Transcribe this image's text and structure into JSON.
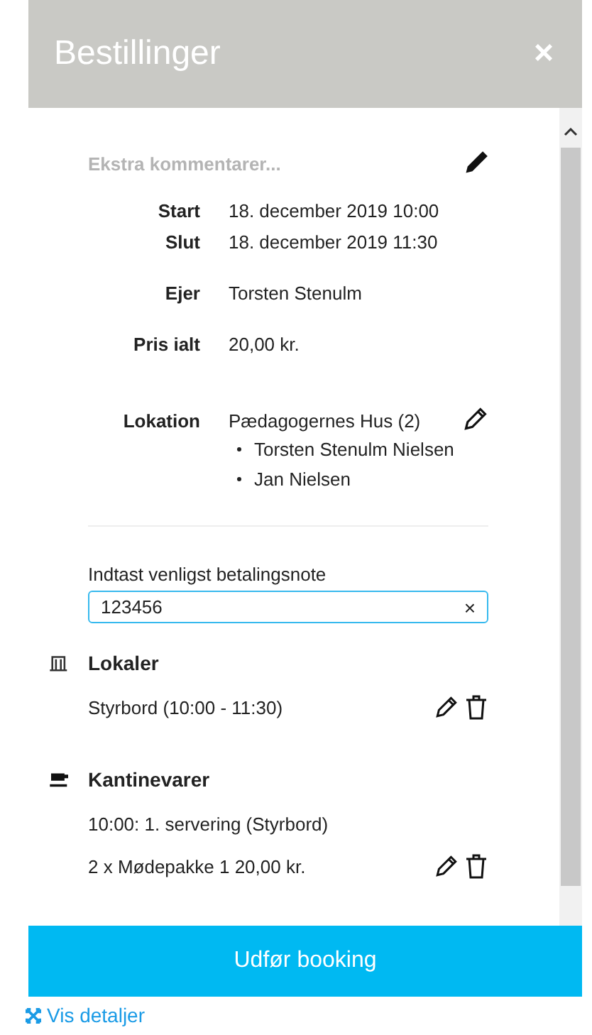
{
  "header": {
    "title": "Bestillinger",
    "close": "×"
  },
  "comment": {
    "placeholder": "Ekstra kommentarer..."
  },
  "details": [
    {
      "label": "Start",
      "value": "18. december 2019 10:00"
    },
    {
      "label": "Slut",
      "value": "18. december 2019 11:30"
    },
    {
      "label": "Ejer",
      "value": "Torsten Stenulm"
    },
    {
      "label": "Pris ialt",
      "value": "20,00 kr."
    }
  ],
  "location": {
    "label": "Lokation",
    "value": "Pædagogernes Hus (2)",
    "people": [
      "Torsten Stenulm Nielsen",
      "Jan Nielsen"
    ]
  },
  "note": {
    "label": "Indtast venligst betalingsnote",
    "value": "123456",
    "clear": "×"
  },
  "sections": [
    {
      "kind": "rooms",
      "title": "Lokaler",
      "lines": [
        {
          "text": "Styrbord (10:00 - 11:30)",
          "actions": true
        }
      ]
    },
    {
      "kind": "canteen",
      "title": "Kantinevarer",
      "lines": [
        {
          "text": "10:00: 1. servering (Styrbord)",
          "actions": false
        },
        {
          "text": "2 x Mødepakke 1 20,00 kr.",
          "actions": true
        }
      ]
    }
  ],
  "submit": "Udfør booking",
  "details_link": "Vis detaljer"
}
